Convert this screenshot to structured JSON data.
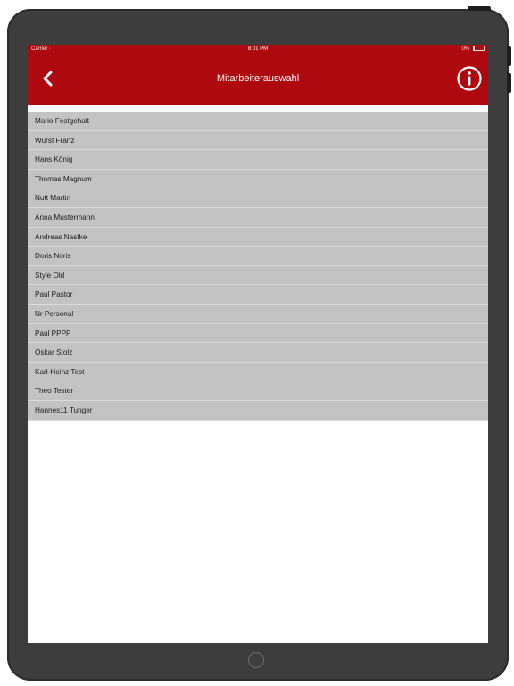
{
  "status_bar": {
    "carrier": "Carrier",
    "time": "8:01 PM",
    "battery": "0%"
  },
  "navbar": {
    "title": "Mitarbeiterauswahl",
    "back_icon": "chevron-left-icon",
    "info_icon": "info-circle-icon"
  },
  "colors": {
    "accent": "#ad090f",
    "row_background": "#c3c3c3",
    "device_frame": "#3d3d3d"
  },
  "employees": [
    "Mario Festgehalt",
    "Wurst Franz",
    "Hans König",
    "Thomas Magnum",
    "Nutt Martin",
    "Anna Mustermann",
    "Andreas Nastke",
    "Doris Noris",
    "Style Old",
    "Paul Pastor",
    "Nr Personal",
    "Paul PPPP",
    "Oskar Stolz",
    "Karl-Heinz Test",
    "Theo Tester",
    "Hannes11 Tunger"
  ]
}
